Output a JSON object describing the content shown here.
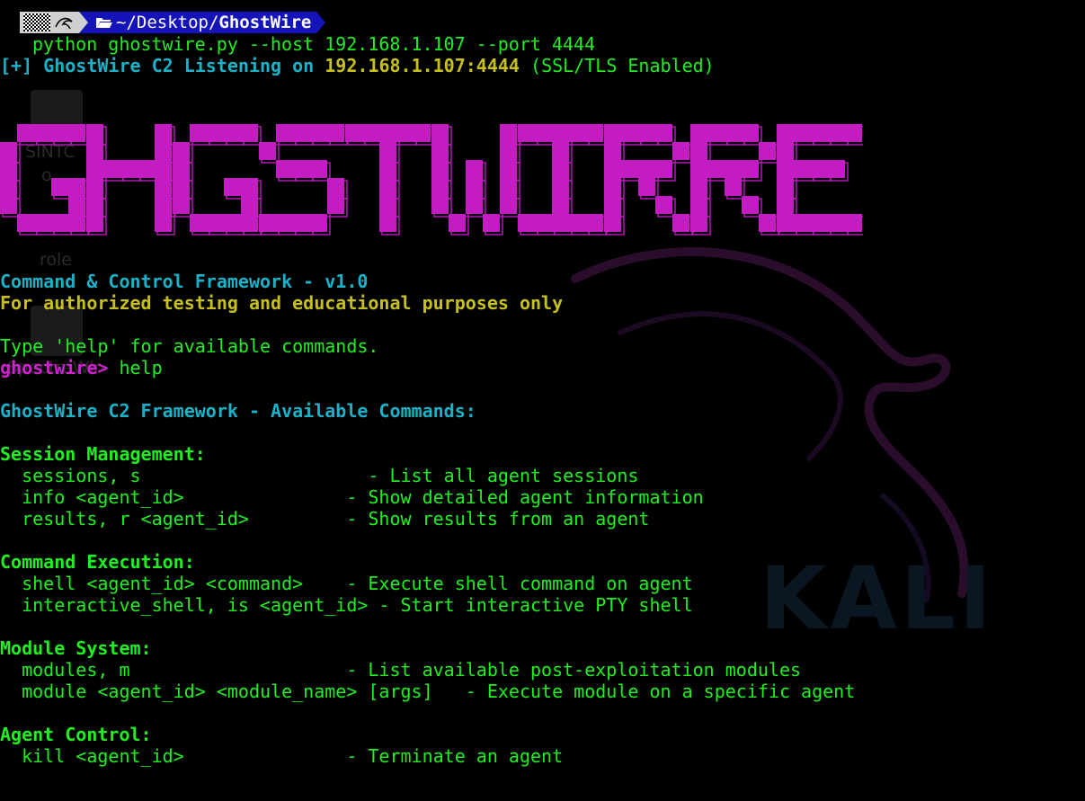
{
  "prompt_bar": {
    "dir_prefix": "~/Desktop/",
    "dir_name": "GhostWire"
  },
  "command_line": "python ghostwire.py --host 192.168.1.107 --port 4444",
  "listen_line": {
    "prefix": "[+] GhostWire C2 Listening on ",
    "address": "192.168.1.107:4444",
    "suffix": " (SSL/TLS Enabled)"
  },
  "banner_text": "GHGSTWIRRE",
  "desktop_ghosts": [
    "SINTC",
    "o",
    "role",
    "SpectreWir-"
  ],
  "wallpaper_text": "KALI",
  "framework_line": "Command & Control Framework - v1.0",
  "disclaimer_line": "For authorized testing and educational purposes only",
  "hint_line": "Type 'help' for available commands.",
  "shell_prompt": "ghostwire>",
  "entered_command": " help",
  "help_title": "GhostWire C2 Framework - Available Commands:",
  "sections": [
    {
      "heading": "Session Management:",
      "lines": [
        "  sessions, s                     - List all agent sessions",
        "  info <agent_id>               - Show detailed agent information",
        "  results, r <agent_id>         - Show results from an agent"
      ]
    },
    {
      "heading": "Command Execution:",
      "lines": [
        "  shell <agent_id> <command>    - Execute shell command on agent",
        "  interactive_shell, is <agent_id> - Start interactive PTY shell"
      ]
    },
    {
      "heading": "Module System:",
      "lines": [
        "  modules, m                    - List available post-exploitation modules",
        "  module <agent_id> <module_name> [args]   - Execute module on a specific agent"
      ]
    },
    {
      "heading": "Agent Control:",
      "lines": [
        "  kill <agent_id>               - Terminate an agent"
      ]
    }
  ],
  "colors": {
    "background": "#000000",
    "green": "#1ff01f",
    "cyan": "#1ab2c8",
    "yellow": "#c8c01a",
    "magenta": "#d21fd2",
    "prompt_dir_bg": "#1414b8"
  }
}
